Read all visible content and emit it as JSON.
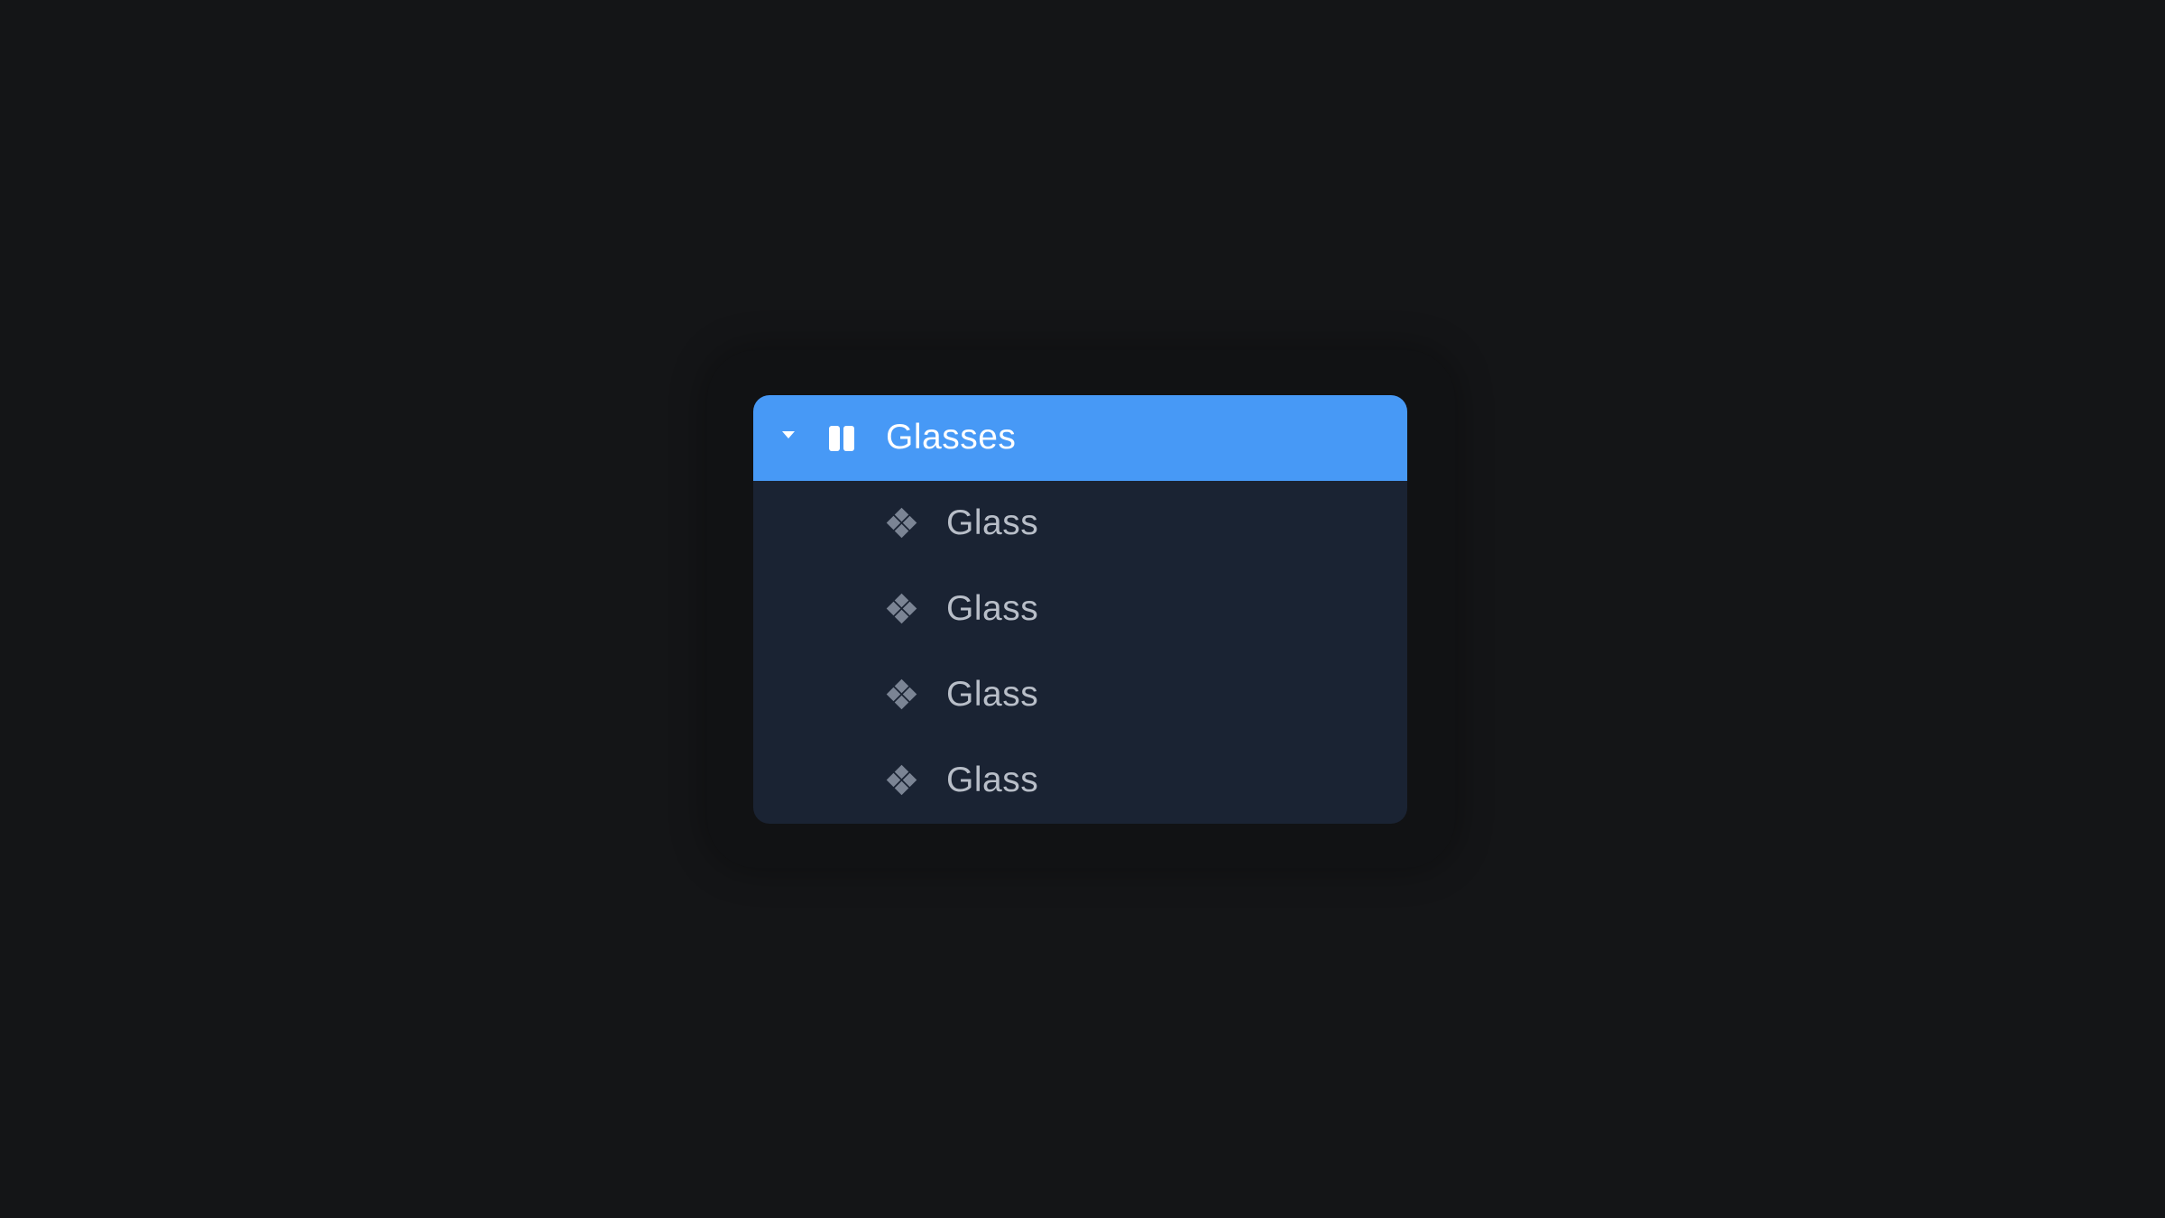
{
  "layer_panel": {
    "parent": {
      "label": "Glasses",
      "expand_icon": "caret-down-icon",
      "type_icon": "frame-columns-icon"
    },
    "children": [
      {
        "label": "Glass",
        "icon": "component-instance-icon"
      },
      {
        "label": "Glass",
        "icon": "component-instance-icon"
      },
      {
        "label": "Glass",
        "icon": "component-instance-icon"
      },
      {
        "label": "Glass",
        "icon": "component-instance-icon"
      }
    ]
  },
  "colors": {
    "page_background": "#141517",
    "panel_background": "#1a2333",
    "selected_row": "#4799f6",
    "child_text": "#b8bec8",
    "child_icon": "#7b8494"
  }
}
